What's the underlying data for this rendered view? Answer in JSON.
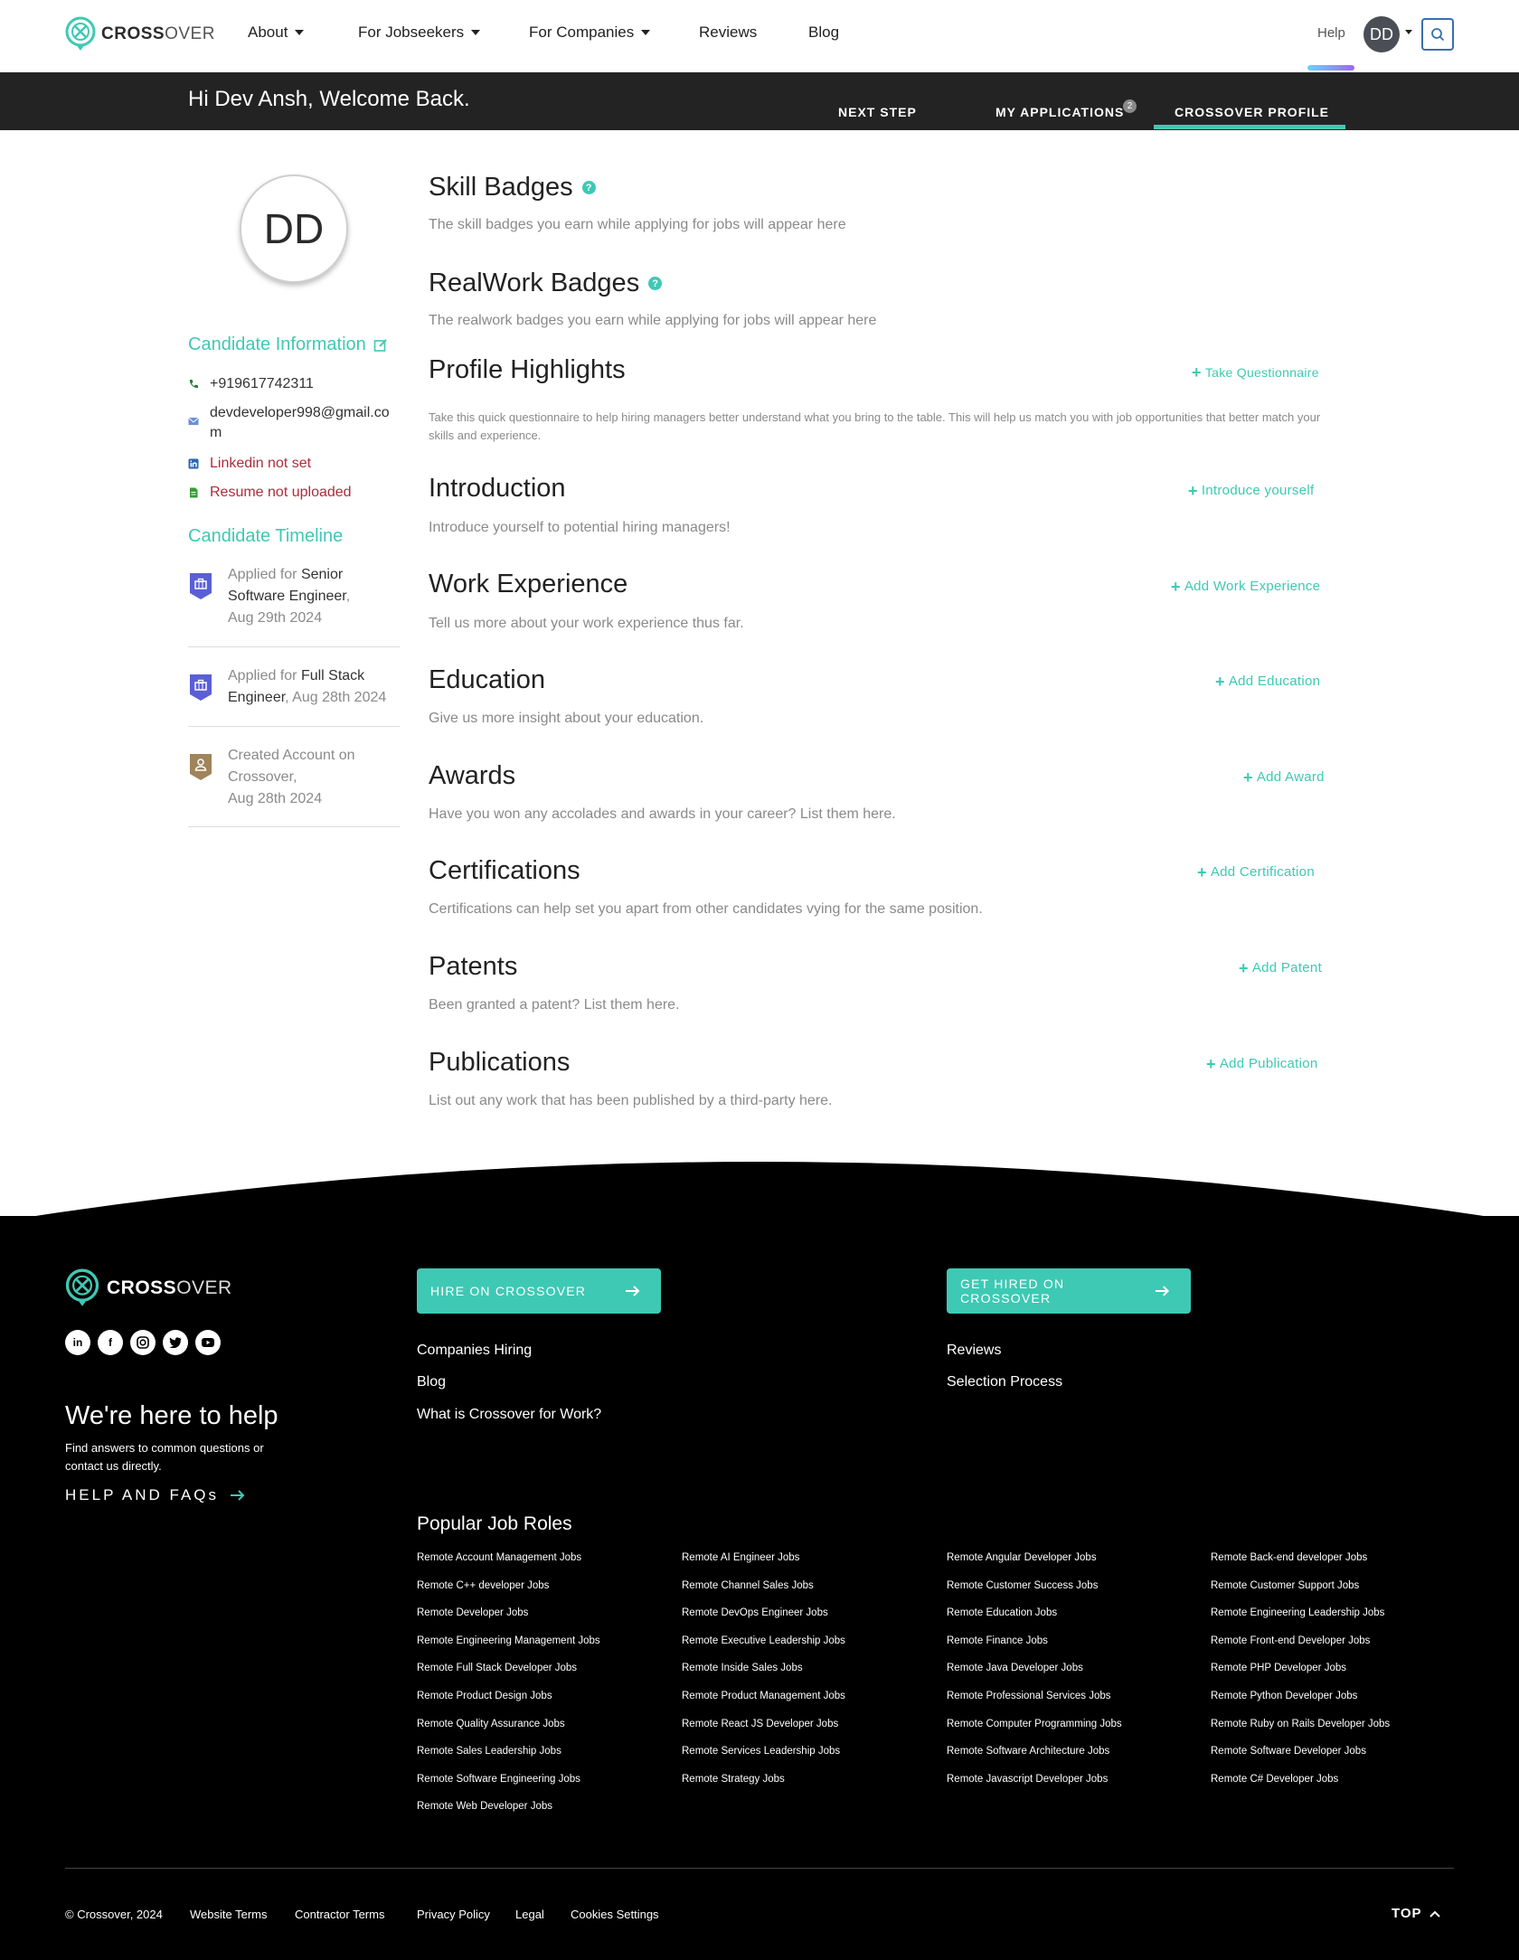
{
  "brand": {
    "name_bold": "CROSS",
    "name_light": "OVER",
    "accent": "#3ec9b4"
  },
  "nav": {
    "items": [
      {
        "label": "About",
        "dropdown": true
      },
      {
        "label": "For Jobseekers",
        "dropdown": true
      },
      {
        "label": "For Companies",
        "dropdown": true
      },
      {
        "label": "Reviews",
        "dropdown": false
      },
      {
        "label": "Blog",
        "dropdown": false
      }
    ],
    "help": "Help",
    "avatar_initials": "DD",
    "search_icon": "search-icon"
  },
  "header": {
    "welcome": "Hi Dev Ansh, Welcome Back.",
    "tabs": [
      {
        "label": "NEXT STEP"
      },
      {
        "label": "MY APPLICATIONS",
        "badge": "2"
      },
      {
        "label": "CROSSOVER PROFILE",
        "active": true
      }
    ]
  },
  "sidebar": {
    "initials": "DD",
    "info_title": "Candidate Information",
    "phone": "+919617742311",
    "email": "devdeveloper998@gmail.com",
    "email_line1": "devdeveloper998@gmail.co",
    "email_line2": "m",
    "linkedin": "Linkedin not set",
    "resume": "Resume not uploaded",
    "timeline_title": "Candidate Timeline",
    "timeline": [
      {
        "prefix": "Applied for ",
        "highlight1": "Senior",
        "highlight2": "Software Engineer",
        "suffix": ",",
        "date": "Aug 29th 2024",
        "icon": "briefcase-icon"
      },
      {
        "prefix": "Applied for ",
        "highlight1": "Full Stack",
        "highlight2": "Engineer",
        "suffix": ", Aug 28th 2024",
        "icon": "briefcase-icon"
      },
      {
        "line1": "Created Account on",
        "line2": "Crossover,",
        "date": "Aug 28th 2024",
        "icon": "user-icon"
      }
    ]
  },
  "sections": [
    {
      "title": "Skill Badges",
      "help": "?",
      "desc": "The skill badges you earn while applying for jobs will appear here"
    },
    {
      "title": "RealWork Badges",
      "help": "?",
      "desc": "The realwork badges you earn while applying for jobs will appear here"
    },
    {
      "title": "Profile Highlights",
      "action": "Take Questionnaire",
      "desc": "Take this quick questionnaire to help hiring managers better understand what you bring to the table. This will help us match you with job opportunities that better match your skills and experience."
    },
    {
      "title": "Introduction",
      "action": "Introduce yourself",
      "desc": "Introduce yourself to potential hiring managers!"
    },
    {
      "title": "Work Experience",
      "action": "Add Work Experience",
      "desc": "Tell us more about your work experience thus far."
    },
    {
      "title": "Education",
      "action": "Add Education",
      "desc": "Give us more insight about your education."
    },
    {
      "title": "Awards",
      "action": "Add Award",
      "desc": "Have you won any accolades and awards in your career? List them here."
    },
    {
      "title": "Certifications",
      "action": "Add Certification",
      "desc": "Certifications can help set you apart from other candidates vying for the same position."
    },
    {
      "title": "Patents",
      "action": "Add Patent",
      "desc": "Been granted a patent? List them here."
    },
    {
      "title": "Publications",
      "action": "Add Publication",
      "desc": "List out any work that has been published by a third-party here."
    }
  ],
  "footer": {
    "social": [
      "linkedin-icon",
      "facebook-icon",
      "instagram-icon",
      "twitter-icon",
      "youtube-icon"
    ],
    "help_title": "We're here to help",
    "help_text": "Find answers to common questions or contact us directly.",
    "faq_label": "HELP AND FAQs",
    "hire_button": "HIRE ON CROSSOVER",
    "get_hired_button": "GET HIRED ON CROSSOVER",
    "links_left": [
      "Companies Hiring",
      "Blog",
      "What is Crossover for Work?"
    ],
    "links_right": [
      "Reviews",
      "Selection Process"
    ],
    "popular_title": "Popular Job Roles",
    "jobs": [
      [
        "Remote Account Management Jobs",
        "Remote AI Engineer Jobs",
        "Remote Angular Developer Jobs",
        "Remote Back-end developer Jobs"
      ],
      [
        "Remote C++ developer Jobs",
        "Remote Channel Sales Jobs",
        "Remote Customer Success Jobs",
        "Remote Customer Support Jobs"
      ],
      [
        "Remote Developer Jobs",
        "Remote DevOps Engineer Jobs",
        "Remote Education Jobs",
        "Remote Engineering Leadership Jobs"
      ],
      [
        "Remote Engineering Management Jobs",
        "Remote Executive Leadership Jobs",
        "Remote Finance Jobs",
        "Remote Front-end Developer Jobs"
      ],
      [
        "Remote Full Stack Developer Jobs",
        "Remote Inside Sales Jobs",
        "Remote Java Developer Jobs",
        "Remote PHP Developer Jobs"
      ],
      [
        "Remote Product Design Jobs",
        "Remote Product Management Jobs",
        "Remote Professional Services Jobs",
        "Remote Python Developer Jobs"
      ],
      [
        "Remote Quality Assurance Jobs",
        "Remote React JS Developer Jobs",
        "Remote Computer Programming Jobs",
        "Remote Ruby on Rails Developer Jobs"
      ],
      [
        "Remote Sales Leadership Jobs",
        "Remote Services Leadership Jobs",
        "Remote Software Architecture Jobs",
        "Remote Software Developer Jobs"
      ],
      [
        "Remote Software Engineering Jobs",
        "Remote Strategy Jobs",
        "Remote Javascript Developer Jobs",
        "Remote C# Developer Jobs"
      ],
      [
        "Remote Web Developer Jobs"
      ]
    ],
    "bottom_links": [
      "© Crossover, 2024",
      "Website Terms",
      "Contractor Terms",
      "Privacy Policy",
      "Legal",
      "Cookies Settings"
    ],
    "top_label": "TOP"
  }
}
